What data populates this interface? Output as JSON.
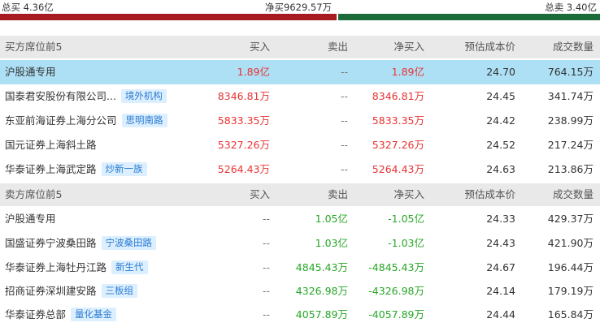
{
  "summary": {
    "total_buy": "总买 4.36亿",
    "net_buy": "净买9629.57万",
    "total_sell": "总卖 3.40亿",
    "bar_buy_share": 0.562,
    "colors": {
      "buy": "#a81a22",
      "sell": "#1d6b3a"
    }
  },
  "buy_section": {
    "title": "买方席位前5",
    "headers": [
      "买入",
      "卖出",
      "净买入",
      "预估成本价",
      "成交数量"
    ],
    "rows": [
      {
        "name": "沪股通专用",
        "tag": "",
        "buy": "1.89亿",
        "sell": "--",
        "net": "1.89亿",
        "cost": "24.70",
        "volume": "764.15万",
        "highlight": true
      },
      {
        "name": "国泰君安股份有限公司...",
        "tag": "境外机构",
        "buy": "8346.81万",
        "sell": "--",
        "net": "8346.81万",
        "cost": "24.45",
        "volume": "341.74万"
      },
      {
        "name": "东亚前海证券上海分公司",
        "tag": "思明南路",
        "buy": "5833.35万",
        "sell": "--",
        "net": "5833.35万",
        "cost": "24.42",
        "volume": "238.99万"
      },
      {
        "name": "国元证券上海斜土路",
        "tag": "",
        "buy": "5327.26万",
        "sell": "--",
        "net": "5327.26万",
        "cost": "24.52",
        "volume": "217.24万"
      },
      {
        "name": "华泰证券上海武定路",
        "tag": "炒新一族",
        "buy": "5264.43万",
        "sell": "--",
        "net": "5264.43万",
        "cost": "24.63",
        "volume": "213.86万"
      }
    ]
  },
  "sell_section": {
    "title": "卖方席位前5",
    "headers": [
      "买入",
      "卖出",
      "净买入",
      "预估成本价",
      "成交数量"
    ],
    "rows": [
      {
        "name": "沪股通专用",
        "tag": "",
        "buy": "--",
        "sell": "1.05亿",
        "net": "-1.05亿",
        "cost": "24.33",
        "volume": "429.37万"
      },
      {
        "name": "国盛证券宁波桑田路",
        "tag": "宁波桑田路",
        "buy": "--",
        "sell": "1.03亿",
        "net": "-1.03亿",
        "cost": "24.43",
        "volume": "421.90万"
      },
      {
        "name": "华泰证券上海牡丹江路",
        "tag": "新生代",
        "buy": "--",
        "sell": "4845.43万",
        "net": "-4845.43万",
        "cost": "24.67",
        "volume": "196.44万"
      },
      {
        "name": "招商证券深圳建安路",
        "tag": "三板组",
        "buy": "--",
        "sell": "4326.98万",
        "net": "-4326.98万",
        "cost": "24.14",
        "volume": "179.19万"
      },
      {
        "name": "华泰证券总部",
        "tag": "量化基金",
        "buy": "--",
        "sell": "4057.89万",
        "net": "-4057.89万",
        "cost": "24.44",
        "volume": "165.84万"
      }
    ]
  }
}
